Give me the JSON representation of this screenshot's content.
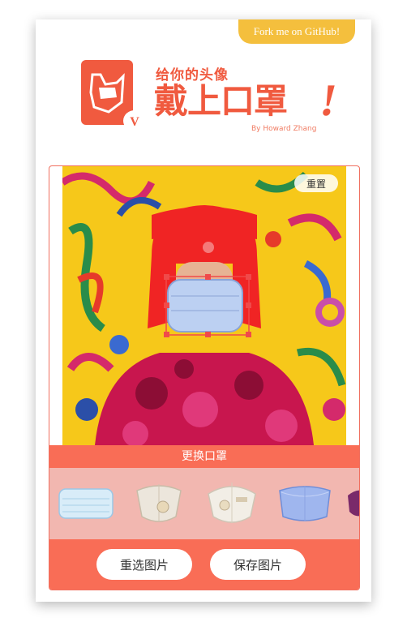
{
  "ribbon": {
    "label": "Fork me on GitHub!"
  },
  "logo": {
    "letter": "V",
    "subtitle": "给你的头像",
    "title": "戴上口罩",
    "exclaim": "!",
    "author": "By Howard Zhang"
  },
  "editor": {
    "reset_label": "重置"
  },
  "masks": {
    "bar_label": "更换口罩"
  },
  "actions": {
    "reselect_label": "重选图片",
    "save_label": "保存图片"
  },
  "colors": {
    "accent": "#f96d56",
    "strip": "#f2b7b0",
    "ribbon": "#f4bf3d"
  }
}
